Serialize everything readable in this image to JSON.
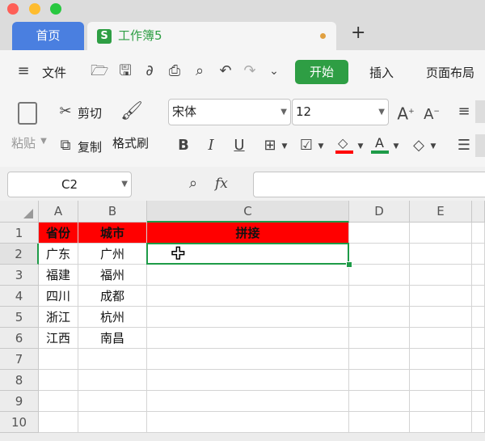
{
  "window": {
    "tab_home": "首页",
    "tab_doc": "工作簿5",
    "new_tab": "+"
  },
  "toolbar": {
    "file_label": "文件",
    "ribbon_tabs": [
      "开始",
      "插入",
      "页面布局"
    ]
  },
  "ribbon": {
    "paste": "粘贴",
    "cut": "剪切",
    "copy": "复制",
    "format_painter": "格式刷",
    "font_name": "宋体",
    "font_size": "12"
  },
  "formula_bar": {
    "name_box": "C2",
    "fx": "fx",
    "content": ""
  },
  "sheet": {
    "columns": [
      "A",
      "B",
      "C",
      "D",
      "E"
    ],
    "rows": [
      "1",
      "2",
      "3",
      "4",
      "5",
      "6",
      "7",
      "8",
      "9",
      "10"
    ],
    "data": [
      [
        "省份",
        "城市",
        "拼接"
      ],
      [
        "广东",
        "广州",
        ""
      ],
      [
        "福建",
        "福州",
        ""
      ],
      [
        "四川",
        "成都",
        ""
      ],
      [
        "浙江",
        "杭州",
        ""
      ],
      [
        "江西",
        "南昌",
        ""
      ]
    ],
    "selected_cell": "C2",
    "colors": {
      "header_fill": "#ff0000",
      "selection": "#1e9b48",
      "accent_green": "#2e9e44"
    }
  }
}
